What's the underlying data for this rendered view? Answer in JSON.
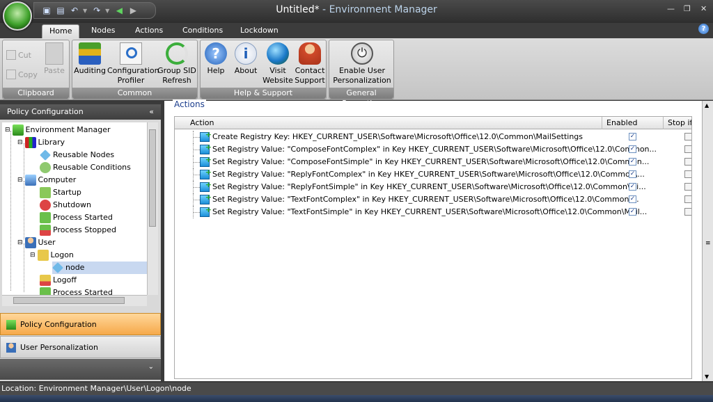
{
  "window": {
    "title_main": "Untitled*",
    "title_sep": " - ",
    "title_app": "Environment Manager"
  },
  "tabs": [
    "Home",
    "Nodes",
    "Actions",
    "Conditions",
    "Lockdown"
  ],
  "ribbon": {
    "clipboard": {
      "label": "Clipboard",
      "cut": "Cut",
      "copy": "Copy",
      "paste": "Paste"
    },
    "common": {
      "label": "Common",
      "auditing": "Auditing",
      "config1": "Configuration",
      "config2": "Profiler",
      "sid1": "Group SID",
      "sid2": "Refresh"
    },
    "help": {
      "label": "Help & Support",
      "help": "Help",
      "about": "About",
      "visit1": "Visit",
      "visit2": "Website",
      "contact1": "Contact",
      "contact2": "Support"
    },
    "general": {
      "label": "General Properties",
      "enable1": "Enable User",
      "enable2": "Personalization"
    }
  },
  "left": {
    "header": "Policy Configuration",
    "tree": [
      "Environment Manager",
      "Library",
      "Reusable Nodes",
      "Reusable Conditions",
      "Computer",
      "Startup",
      "Shutdown",
      "Process Started",
      "Process Stopped",
      "User",
      "Logon",
      "node",
      "Logoff",
      "Process Started"
    ],
    "nav1": "Policy Configuration",
    "nav2": "User Personalization"
  },
  "actions": {
    "group_label": "Actions",
    "columns": [
      "Action",
      "Enabled",
      "Stop if f"
    ],
    "rows": [
      "Create Registry Key: HKEY_CURRENT_USER\\Software\\Microsoft\\Office\\12.0\\Common\\MailSettings",
      "Set Registry Value: \"ComposeFontComplex\" in Key HKEY_CURRENT_USER\\Software\\Microsoft\\Office\\12.0\\Common...",
      "Set Registry Value: \"ComposeFontSimple\" in Key HKEY_CURRENT_USER\\Software\\Microsoft\\Office\\12.0\\Common...",
      "Set Registry Value: \"ReplyFontComplex\" in Key HKEY_CURRENT_USER\\Software\\Microsoft\\Office\\12.0\\Common\\...",
      "Set Registry Value: \"ReplyFontSimple\" in Key HKEY_CURRENT_USER\\Software\\Microsoft\\Office\\12.0\\Common\\Mi...",
      "Set Registry Value: \"TextFontComplex\" in Key HKEY_CURRENT_USER\\Software\\Microsoft\\Office\\12.0\\Common\\...",
      "Set Registry Value: \"TextFontSimple\" in Key HKEY_CURRENT_USER\\Software\\Microsoft\\Office\\12.0\\Common\\Mail..."
    ]
  },
  "status": "Location: Environment Manager\\User\\Logon\\node"
}
